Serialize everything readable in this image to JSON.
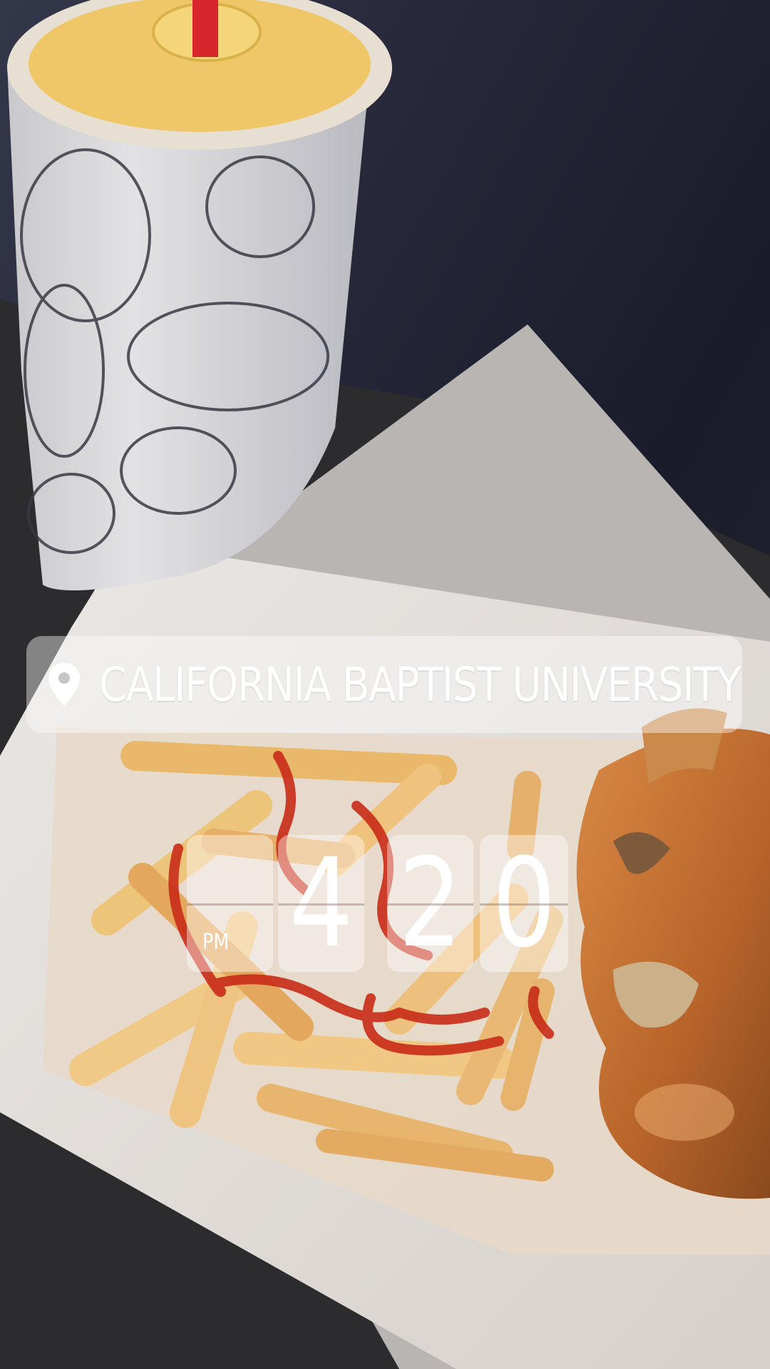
{
  "location_sticker": {
    "icon": "map-pin-icon",
    "label": "CALIFORNIA BAPTIST UNIVERSITY"
  },
  "time_sticker": {
    "period": "PM",
    "hour": "4",
    "minute_tens": "2",
    "minute_ones": "0"
  },
  "colors": {
    "sticker_text": "#ffffff",
    "sticker_background": "rgba(255,255,255,0.42)"
  }
}
